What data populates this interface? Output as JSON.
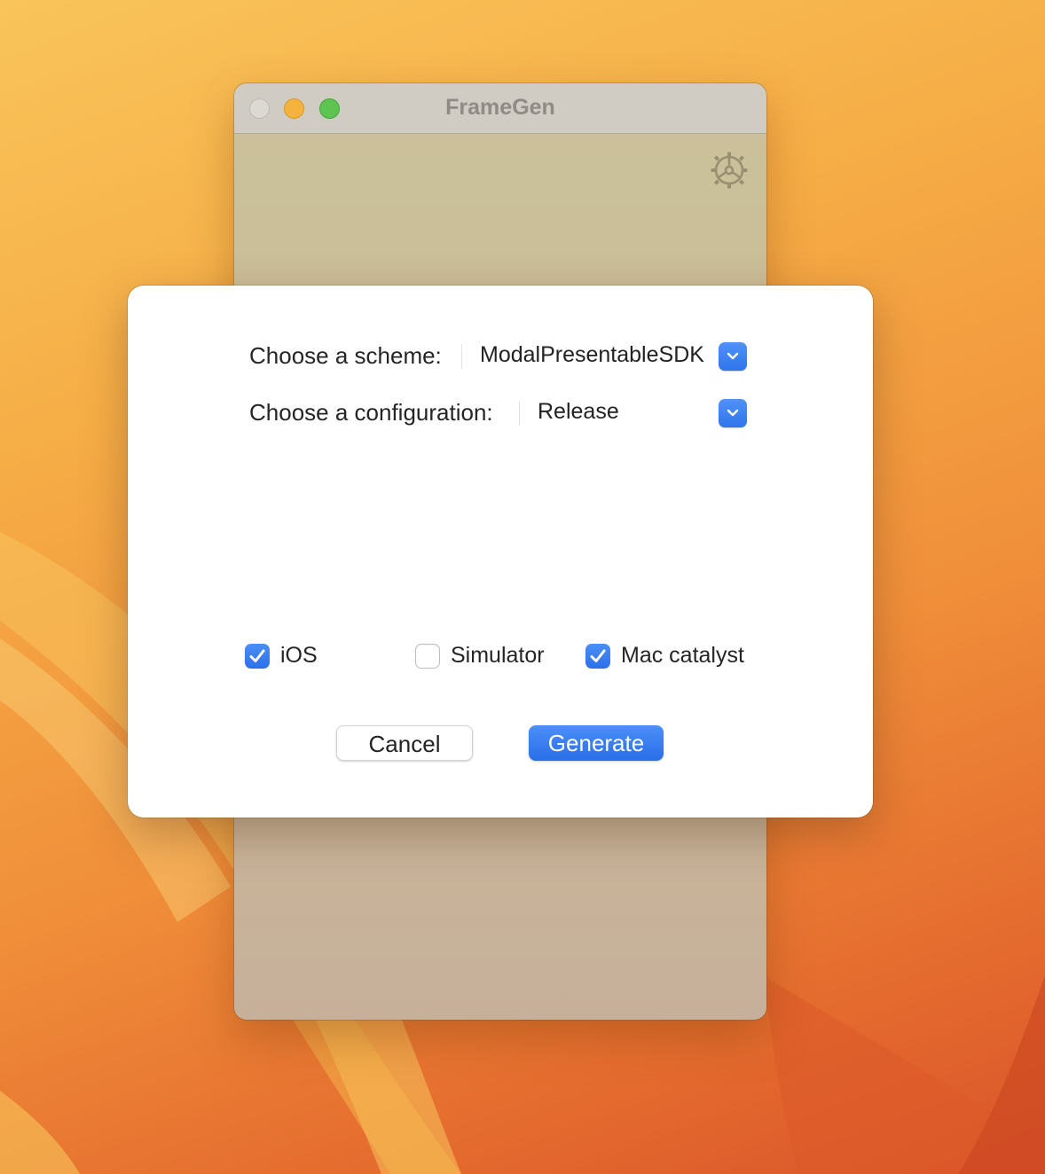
{
  "window": {
    "title": "FrameGen"
  },
  "toolbar": {
    "settings_icon": "gear-icon"
  },
  "dialog": {
    "scheme": {
      "label": "Choose a scheme:",
      "selected": "ModalPresentableSDK"
    },
    "configuration": {
      "label": "Choose a configuration:",
      "selected": "Release"
    },
    "platforms": [
      {
        "label": "iOS",
        "checked": true
      },
      {
        "label": "Simulator",
        "checked": false
      },
      {
        "label": "Mac catalyst",
        "checked": true
      }
    ],
    "buttons": {
      "cancel_label": "Cancel",
      "generate_label": "Generate"
    }
  },
  "colors": {
    "accent": "#2f74ec",
    "wallpaper_top": "#f9c45a",
    "wallpaper_bottom": "#d9542a"
  }
}
